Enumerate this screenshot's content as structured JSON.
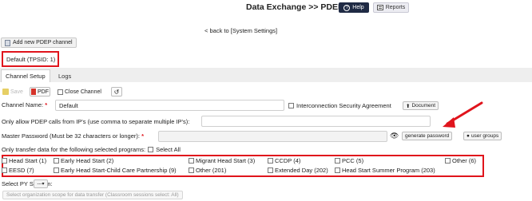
{
  "header": {
    "title": "Data Exchange >> PDEP",
    "help_label": "Help",
    "reports_label": "Reports"
  },
  "nav": {
    "back_link": "back to [System Settings]",
    "add_channel_label": "Add new PDEP channel"
  },
  "channel": {
    "selected": "Default (TPSID: 1)"
  },
  "tabs": [
    {
      "label": "Channel Setup",
      "active": true
    },
    {
      "label": "Logs",
      "active": false
    }
  ],
  "toolbar": {
    "save_label": "Save",
    "pdf_label": "PDF",
    "close_channel_label": "Close Channel"
  },
  "form": {
    "channel_name_label": "Channel Name:",
    "channel_name_value": "Default",
    "interconnection_label": "Interconnection Security Agreement",
    "document_label": "Document",
    "ip_label": "Only allow PDEP calls from IP's (use comma to separate multiple IP's):",
    "ip_value": "",
    "password_label": "Master Password (Must be 32 characters or longer):",
    "password_value": "",
    "generate_password_label": "generate password",
    "user_groups_label": "user groups",
    "programs_label": "Only transfer data for the following selected programs:",
    "select_all_label": "Select All",
    "py_session_label": "Select PY Session:",
    "py_session_value": "---",
    "scope_button_label": "Select organization scope for data transfer (Classroom sessions select: All)"
  },
  "programs": [
    {
      "label": "Head Start (1)",
      "checked": false
    },
    {
      "label": "Early Head Start (2)",
      "checked": false
    },
    {
      "label": "Migrant Head Start (3)",
      "checked": false
    },
    {
      "label": "CCDP (4)",
      "checked": false
    },
    {
      "label": "PCC (5)",
      "checked": false
    },
    {
      "label": "Other (6)",
      "checked": false
    },
    {
      "label": "EESD (7)",
      "checked": false
    },
    {
      "label": "Early Head Start-Child Care Partnership (9)",
      "checked": false
    },
    {
      "label": "Other (201)",
      "checked": false
    },
    {
      "label": "Extended Day (202)",
      "checked": false
    },
    {
      "label": "Head Start Summer Program (203)",
      "checked": false
    }
  ],
  "colors": {
    "highlight": "#e0141c",
    "help_button": "#1f2a44",
    "required_mark": "#e0141c"
  }
}
